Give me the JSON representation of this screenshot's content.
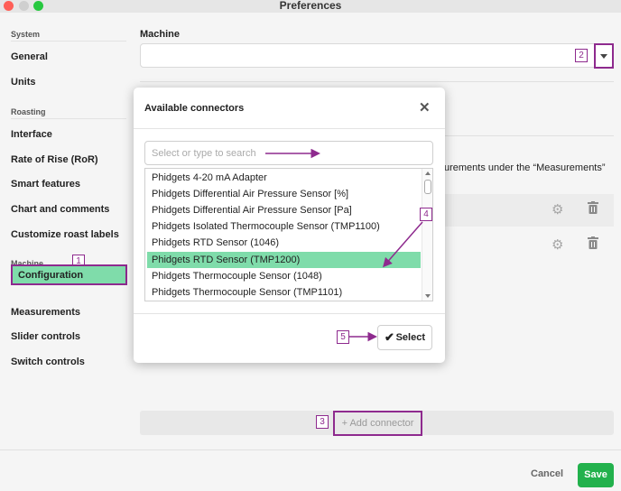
{
  "window": {
    "title": "Preferences"
  },
  "sidebar": {
    "sections": [
      {
        "label": "System"
      },
      {
        "label": "Roasting"
      },
      {
        "label": "Machine"
      }
    ],
    "items": [
      {
        "label": "General"
      },
      {
        "label": "Units"
      },
      {
        "label": "Interface"
      },
      {
        "label": "Rate of Rise (RoR)"
      },
      {
        "label": "Smart features"
      },
      {
        "label": "Chart and comments"
      },
      {
        "label": "Customize roast labels"
      },
      {
        "label": "Configuration"
      },
      {
        "label": "Measurements"
      },
      {
        "label": "Slider controls"
      },
      {
        "label": "Switch controls"
      }
    ]
  },
  "main": {
    "machine_label": "Machine",
    "machine_value": "",
    "background_text": "urements under the “Measurements”",
    "add_connector_label": "Add connector"
  },
  "dialog": {
    "title": "Available connectors",
    "search_placeholder": "Select or type to search",
    "items": [
      "Phidgets 4-20 mA Adapter",
      "Phidgets Differential Air Pressure Sensor [%]",
      "Phidgets Differential Air Pressure Sensor [Pa]",
      "Phidgets Isolated Thermocouple Sensor (TMP1100)",
      "Phidgets RTD Sensor (1046)",
      "Phidgets RTD Sensor (TMP1200)",
      "Phidgets Thermocouple Sensor (1048)",
      "Phidgets Thermocouple Sensor (TMP1101)"
    ],
    "selected_index": 5,
    "select_label": "Select"
  },
  "footer": {
    "cancel_label": "Cancel",
    "save_label": "Save"
  },
  "annotations": [
    "1",
    "2",
    "3",
    "4",
    "5"
  ],
  "colors": {
    "accent": "#7fdcaa",
    "annotation": "#8e2a8e",
    "save": "#22b14c"
  },
  "icons": [
    "gear-icon",
    "trash-icon",
    "close-icon",
    "check-icon",
    "chevron-down-icon",
    "plus-icon"
  ]
}
